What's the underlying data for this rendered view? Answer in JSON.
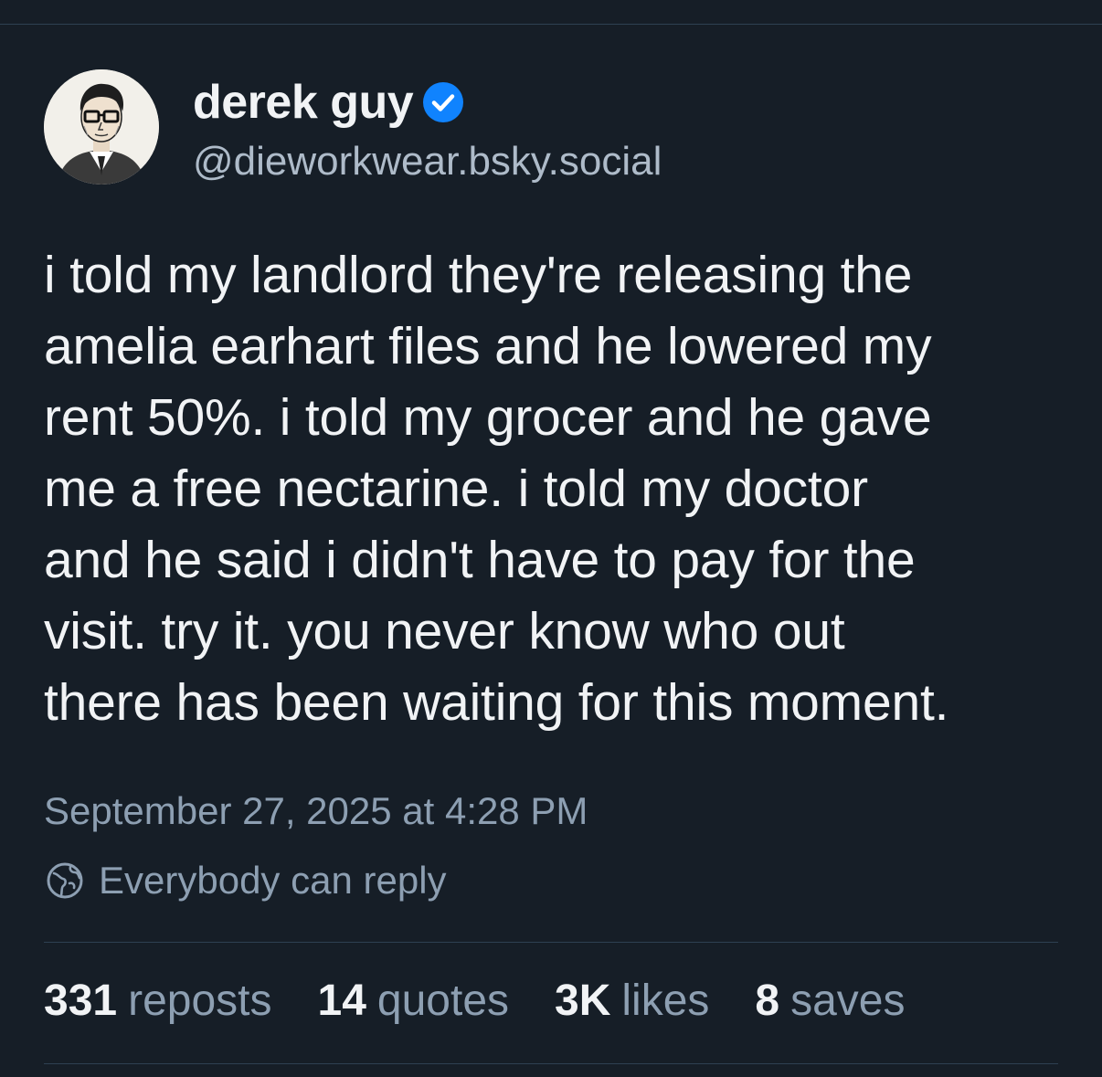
{
  "author": {
    "display_name": "derek guy",
    "handle": "@dieworkwear.bsky.social",
    "verified": true,
    "avatar_icon": "illustrated-portrait-avatar"
  },
  "post": {
    "text_lines": [
      "i told my landlord they're releasing the",
      "amelia earhart files and he lowered my",
      "rent 50%. i told my grocer and he gave",
      "me a free nectarine. i told my doctor",
      "and he said i didn't have to pay for the",
      "visit. try it. you never know who out",
      "there has been waiting for this moment."
    ],
    "timestamp": "September 27, 2025 at 4:28 PM",
    "reply_setting": "Everybody can reply",
    "reply_icon": "globe-icon"
  },
  "stats": [
    {
      "count": "331",
      "label": "reposts"
    },
    {
      "count": "14",
      "label": "quotes"
    },
    {
      "count": "3K",
      "label": "likes"
    },
    {
      "count": "8",
      "label": "saves"
    }
  ],
  "colors": {
    "background": "#161e27",
    "primary_text": "#f1f3f5",
    "secondary_text": "#8d9fb2",
    "verified_badge": "#1083fe",
    "divider": "#2e4052"
  }
}
